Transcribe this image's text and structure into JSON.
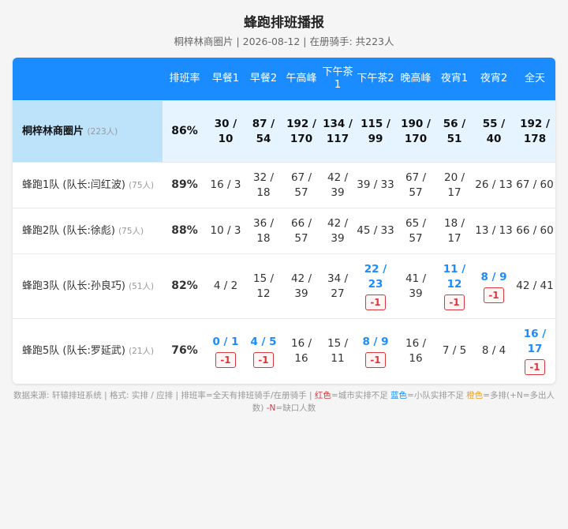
{
  "header": {
    "title": "蜂跑排班播报",
    "subtitle": "桐梓林商圈片 | 2026-08-12 | 在册骑手: 共223人"
  },
  "table": {
    "columns": [
      "",
      "排班率",
      "早餐1",
      "早餐2",
      "午高峰",
      "下午茶1",
      "下午茶2",
      "晚高峰",
      "夜宵1",
      "夜宵2",
      "全天"
    ],
    "summary": {
      "name": "桐梓林商圈片",
      "count": "(223人)",
      "rate": "86%",
      "cells": [
        "30 / 10",
        "87 / 54",
        "192 / 170",
        "134 / 117",
        "115 / 99",
        "190 / 170",
        "56 / 51",
        "55 / 40",
        "192 / 178"
      ]
    },
    "teams": [
      {
        "name": "蜂跑1队 (队长:闫红波)",
        "count": "(75人)",
        "rate": "89%",
        "cells": [
          {
            "value": "16 / 3"
          },
          {
            "value": "32 / 18"
          },
          {
            "value": "67 / 57"
          },
          {
            "value": "42 / 39"
          },
          {
            "value": "39 / 33"
          },
          {
            "value": "67 / 57"
          },
          {
            "value": "20 / 17"
          },
          {
            "value": "26 / 13"
          },
          {
            "value": "67 / 60"
          }
        ]
      },
      {
        "name": "蜂跑2队 (队长:徐彪)",
        "count": "(75人)",
        "rate": "88%",
        "cells": [
          {
            "value": "10 / 3"
          },
          {
            "value": "36 / 18"
          },
          {
            "value": "66 / 57"
          },
          {
            "value": "42 / 39"
          },
          {
            "value": "45 / 33"
          },
          {
            "value": "65 / 57"
          },
          {
            "value": "18 / 17"
          },
          {
            "value": "13 / 13"
          },
          {
            "value": "66 / 60"
          }
        ]
      },
      {
        "name": "蜂跑3队 (队长:孙良巧)",
        "count": "(51人)",
        "rate": "82%",
        "cells": [
          {
            "value": "4 / 2"
          },
          {
            "value": "15 / 12"
          },
          {
            "value": "42 / 39"
          },
          {
            "value": "34 / 27"
          },
          {
            "value": "22 / 23",
            "blue": true,
            "short": "-1"
          },
          {
            "value": "41 / 39"
          },
          {
            "value": "11 / 12",
            "blue": true,
            "short": "-1"
          },
          {
            "value": "8 / 9",
            "blue": true,
            "short": "-1"
          },
          {
            "value": "42 / 41"
          }
        ]
      },
      {
        "name": "蜂跑5队 (队长:罗延武)",
        "count": "(21人)",
        "rate": "76%",
        "cells": [
          {
            "value": "0 / 1",
            "blue": true,
            "short": "-1"
          },
          {
            "value": "4 / 5",
            "blue": true,
            "short": "-1"
          },
          {
            "value": "16 / 16"
          },
          {
            "value": "15 / 11"
          },
          {
            "value": "8 / 9",
            "blue": true,
            "short": "-1"
          },
          {
            "value": "16 / 16"
          },
          {
            "value": "7 / 5"
          },
          {
            "value": "8 / 4"
          },
          {
            "value": "16 / 17",
            "blue": true,
            "short": "-1"
          }
        ]
      }
    ]
  },
  "footer": {
    "part1": "数据来源: 轩辕排班系统 | 格式: 实排 / 应排 | 排班率=全天有排班骑手/在册骑手 | ",
    "red_label": "红色",
    "part2": "=城市实排不足 ",
    "blue_label": "蓝色",
    "part3": "=小队实排不足 ",
    "orange_label": "橙色",
    "part4": "=多排(+N=多出人数) ",
    "n_label": "-N",
    "part5": "=缺口人数"
  },
  "colors": {
    "header_bg": "#1a8cff",
    "summary_name_bg": "#bde3fb",
    "summary_bg": "#e6f4ff",
    "blue": "#1a8cff",
    "red": "#d9363e",
    "orange": "#f0a020"
  }
}
